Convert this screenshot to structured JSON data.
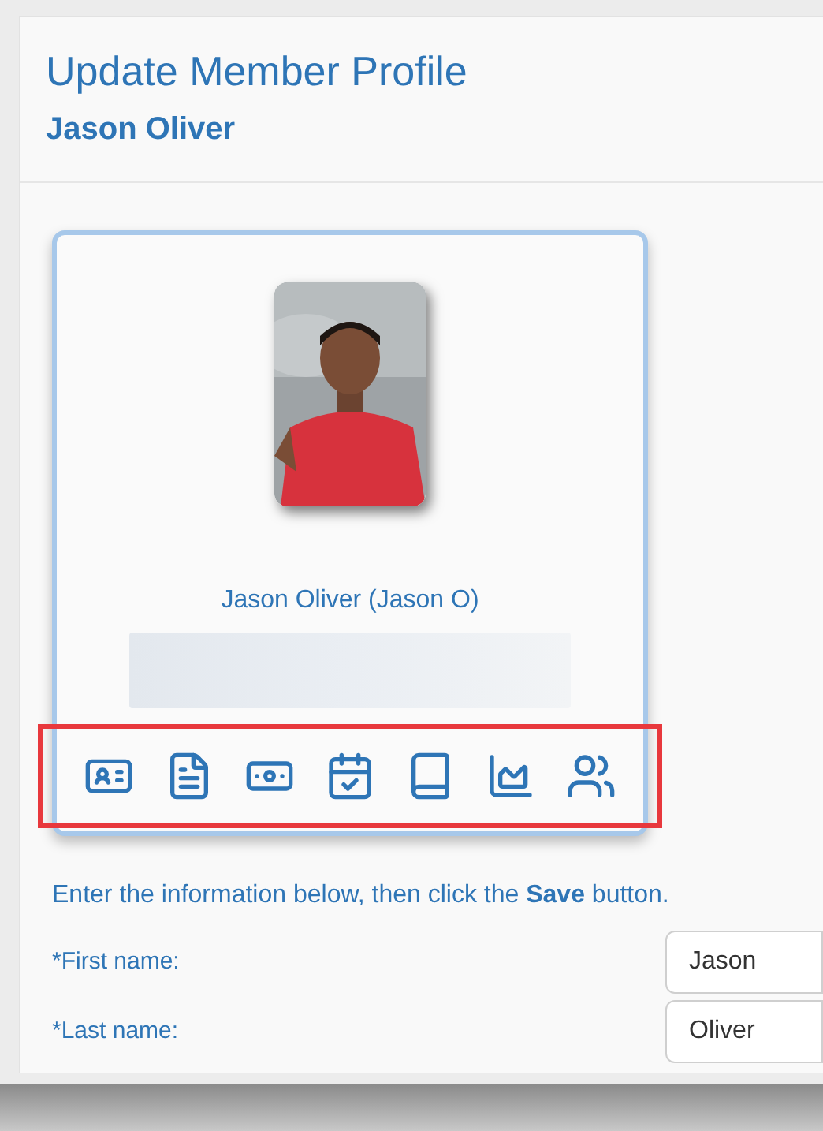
{
  "header": {
    "title": "Update Member Profile",
    "subtitle": "Jason Oliver"
  },
  "profile": {
    "display_name": "Jason Oliver (Jason O)"
  },
  "instructions": "Enter the information below, then click the **Save** button.",
  "fields": [
    {
      "label": "*First name:",
      "value": "Jason"
    },
    {
      "label": "*Last name:",
      "value": "Oliver"
    }
  ]
}
